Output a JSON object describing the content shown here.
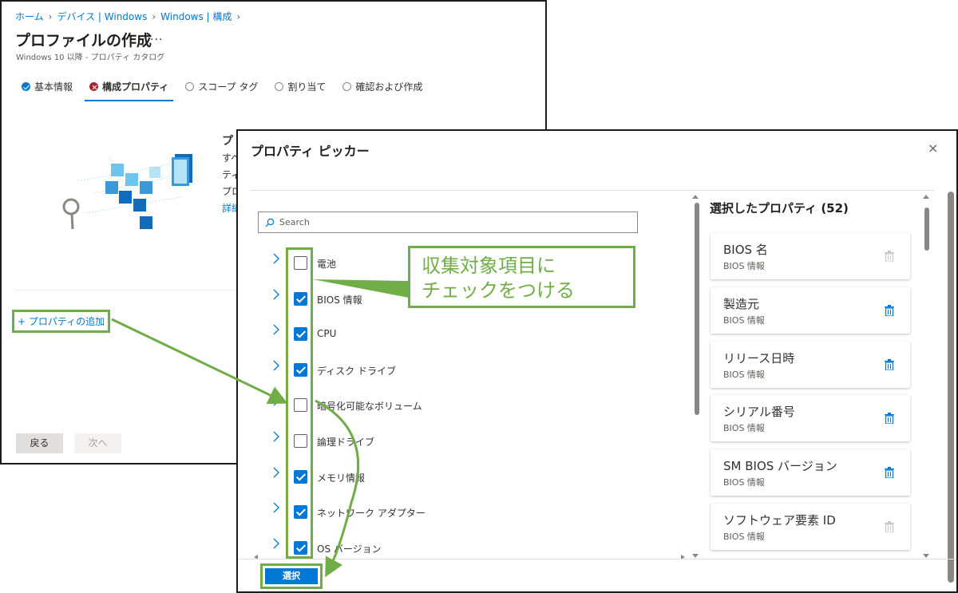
{
  "breadcrumb": [
    "ホーム",
    "デバイス | Windows",
    "Windows | 構成"
  ],
  "page": {
    "title": "プロファイルの作成",
    "more": "...",
    "subtitle": "Windows 10 以降 - プロパティ カタログ"
  },
  "wizard": {
    "steps": [
      {
        "label": "基本情報",
        "state": "done"
      },
      {
        "label": "構成プロパティ",
        "state": "error"
      },
      {
        "label": "スコープ タグ",
        "state": "pending"
      },
      {
        "label": "割り当て",
        "state": "pending"
      },
      {
        "label": "確認および作成",
        "state": "pending"
      }
    ]
  },
  "intro_peek": {
    "title": "プ",
    "lines": [
      "すへ",
      "ティ",
      "プロ"
    ],
    "link": "詳細"
  },
  "add_property": "+ プロパティの追加",
  "nav": {
    "back": "戻る",
    "next": "次へ"
  },
  "dialog": {
    "title": "プロパティ ピッカー",
    "close": "×",
    "search_placeholder": "Search",
    "properties": [
      {
        "label": "電池",
        "checked": false
      },
      {
        "label": "BIOS 情報",
        "checked": true
      },
      {
        "label": "CPU",
        "checked": true
      },
      {
        "label": "ディスク ドライブ",
        "checked": true
      },
      {
        "label": "暗号化可能なボリューム",
        "checked": false
      },
      {
        "label": "論理ドライブ",
        "checked": false
      },
      {
        "label": "メモリ情報",
        "checked": true
      },
      {
        "label": "ネットワーク アダプター",
        "checked": true
      },
      {
        "label": "OS バージョン",
        "checked": true
      }
    ],
    "selected_title": "選択したプロパティ (52)",
    "selected": [
      {
        "name": "BIOS 名",
        "group": "BIOS 情報",
        "removable": false
      },
      {
        "name": "製造元",
        "group": "BIOS 情報",
        "removable": true
      },
      {
        "name": "リリース日時",
        "group": "BIOS 情報",
        "removable": true
      },
      {
        "name": "シリアル番号",
        "group": "BIOS 情報",
        "removable": true
      },
      {
        "name": "SM BIOS バージョン",
        "group": "BIOS 情報",
        "removable": true
      },
      {
        "name": "ソフトウェア要素 ID",
        "group": "BIOS 情報",
        "removable": false
      }
    ],
    "select_button": "選択"
  },
  "annotation": {
    "callout_line1": "収集対象項目に",
    "callout_line2": "チェックをつける"
  },
  "colors": {
    "accent": "#0078d4",
    "annotation": "#70ad47",
    "error": "#a4262c"
  }
}
